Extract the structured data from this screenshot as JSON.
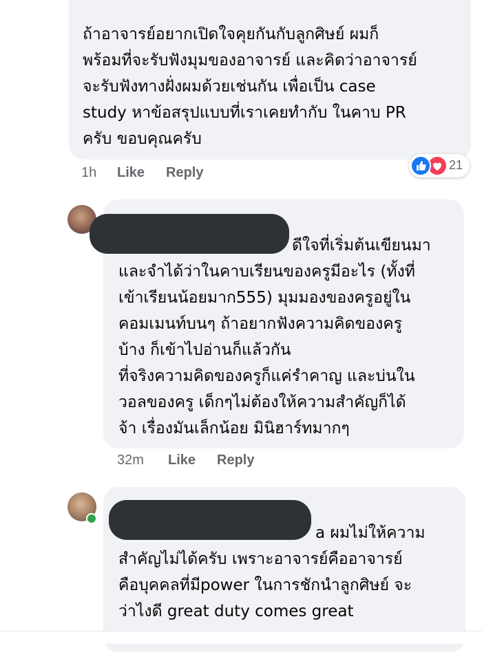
{
  "comments": [
    {
      "lines": [
        "ถ้าอาจารย์อยากเปิดใจคุยกันกับลูกศิษย์ ผมก็",
        "พร้อมที่จะรับฟังมุมของอาจารย์ และคิดว่าอาจารย์",
        "จะรับฟังทางฝั่งผมด้วยเช่นกัน เพื่อเป็น case",
        "study หาข้อสรุปแบบที่เราเคยทำกับ ในคาบ PR",
        "ครับ ขอบคุณครับ"
      ],
      "time": "1h",
      "like_label": "Like",
      "reply_label": "Reply",
      "reaction_count": "21"
    },
    {
      "lines": [
        "ดีใจที่เริ่มต้นเขียนมา",
        "และจำได้ว่าในคาบเรียนของครูมีอะไร (ทั้งที่",
        "เข้าเรียนน้อยมาก555) มุมมองของครูอยู่ใน",
        "คอมเมนท์บนๆ ถ้าอยากฟังความคิดของครู",
        "บ้าง ก็เข้าไปอ่านก็แล้วกัน",
        "ที่จริงความคิดของครูก็แค่รำคาญ และบ่นใน",
        "วอลของครู เด็กๆไม่ต้องให้ความสำคัญก็ได้",
        "จ้า เรื่องมันเล็กน้อย มินิฮาร์ทมากๆ"
      ],
      "time": "32m",
      "like_label": "Like",
      "reply_label": "Reply"
    },
    {
      "lines": [
        "a ผมไม่ให้ความ",
        "สำคัญไม่ได้ครับ เพราะอาจารย์คืออาจารย์",
        "คือบุคคลที่มีpower ในการชักนำลูกศิษย์ จะ",
        "ว่าไงดี great duty comes great"
      ]
    }
  ],
  "icons": {
    "like_reaction": "like-reaction-icon",
    "love_reaction": "love-reaction-icon"
  },
  "colors": {
    "bubble": "#f0f2f5",
    "meta_text": "#65676b",
    "like_blue": "#1877f2",
    "love_red": "#f33e58"
  }
}
